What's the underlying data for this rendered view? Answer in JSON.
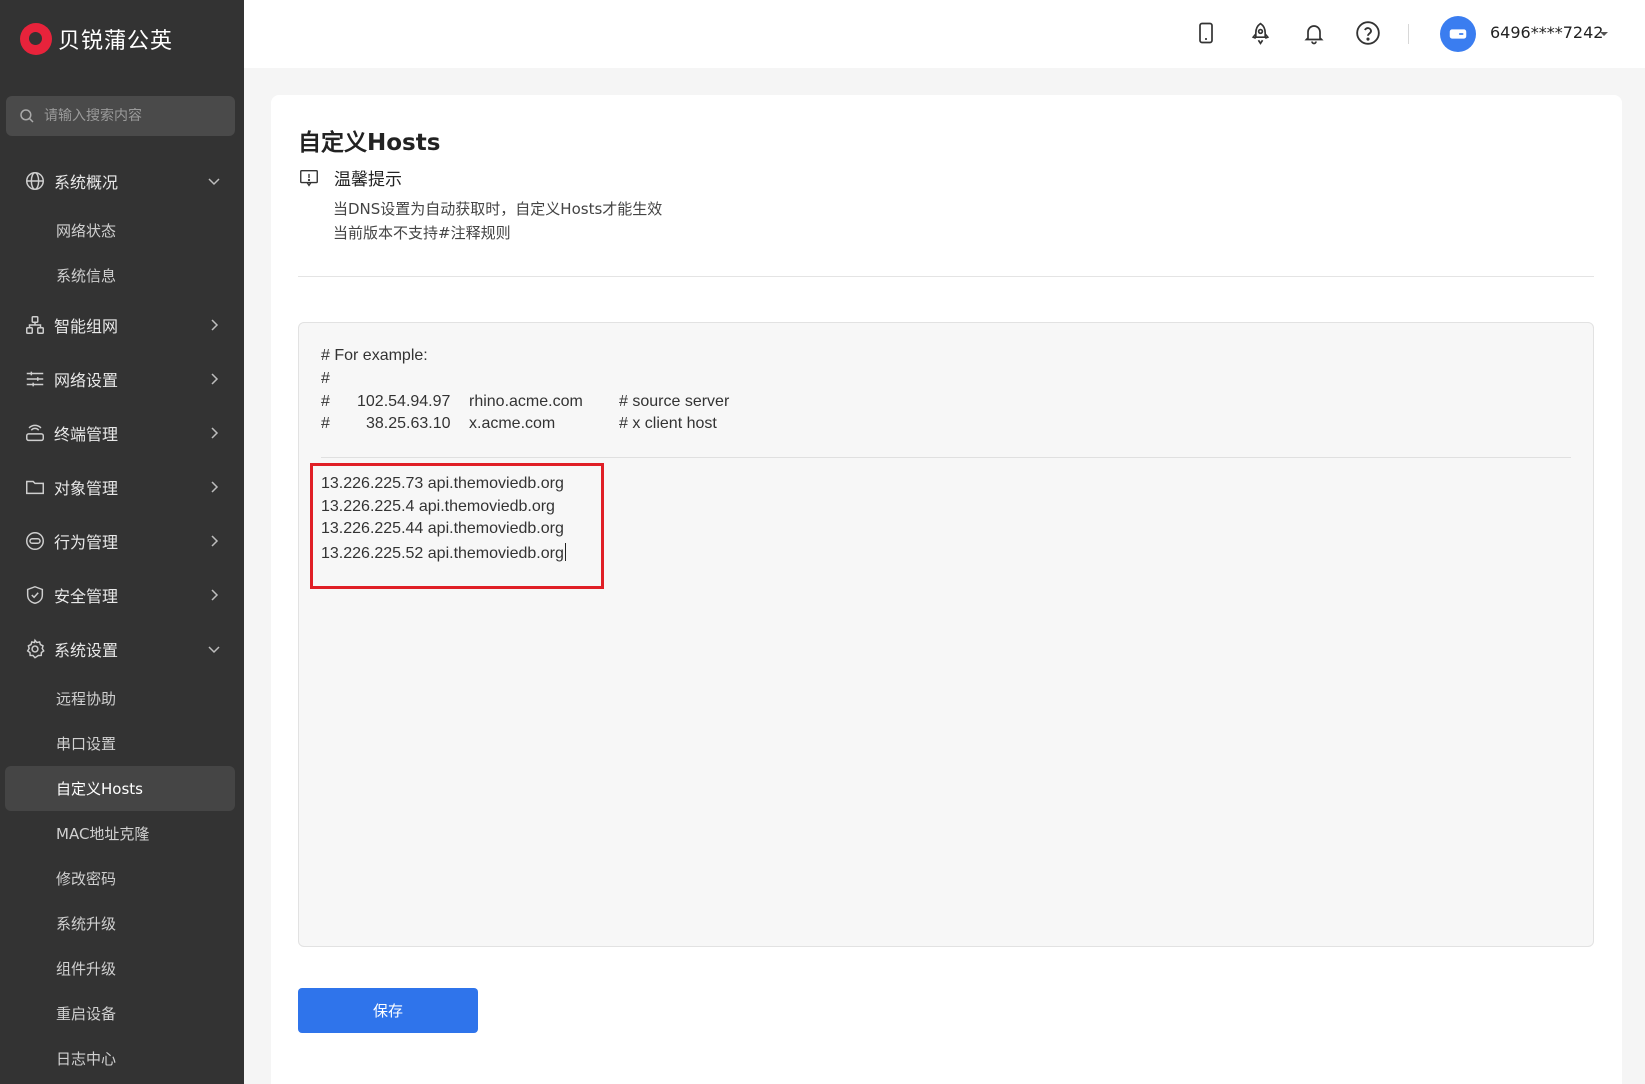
{
  "brand": {
    "name": "贝锐蒲公英"
  },
  "search": {
    "placeholder": "请输入搜索内容"
  },
  "sidebar": {
    "groups": [
      {
        "label": "系统概况",
        "icon": "globe-icon",
        "expanded": true,
        "items": [
          {
            "label": "网络状态"
          },
          {
            "label": "系统信息"
          }
        ]
      },
      {
        "label": "智能组网",
        "icon": "network-icon",
        "expanded": false
      },
      {
        "label": "网络设置",
        "icon": "sliders-icon",
        "expanded": false
      },
      {
        "label": "终端管理",
        "icon": "router-icon",
        "expanded": false
      },
      {
        "label": "对象管理",
        "icon": "folder-icon",
        "expanded": false
      },
      {
        "label": "行为管理",
        "icon": "link-icon",
        "expanded": false
      },
      {
        "label": "安全管理",
        "icon": "shield-icon",
        "expanded": false
      },
      {
        "label": "系统设置",
        "icon": "gear-icon",
        "expanded": true,
        "items": [
          {
            "label": "远程协助"
          },
          {
            "label": "串口设置"
          },
          {
            "label": "自定义Hosts",
            "active": true
          },
          {
            "label": "MAC地址克隆"
          },
          {
            "label": "修改密码"
          },
          {
            "label": "系统升级"
          },
          {
            "label": "组件升级"
          },
          {
            "label": "重启设备"
          },
          {
            "label": "日志中心"
          }
        ]
      }
    ]
  },
  "topbar": {
    "icons": [
      "phone-icon",
      "rocket-icon",
      "bell-icon",
      "help-icon"
    ],
    "username": "6496****7242"
  },
  "main": {
    "title": "自定义Hosts",
    "tip": {
      "title": "温馨提示",
      "lines": [
        "当DNS设置为自动获取时，自定义Hosts才能生效",
        "当前版本不支持#注释规则"
      ]
    },
    "example": {
      "header": "# For example:",
      "blank": "#",
      "rows": [
        {
          "hash": "#",
          "ip": "102.54.94.97",
          "host": "rhino.acme.com",
          "comment": "# source server"
        },
        {
          "hash": "#",
          "ip": "38.25.63.10",
          "host": "x.acme.com",
          "comment": "# x client host"
        }
      ]
    },
    "hosts": [
      "13.226.225.73 api.themoviedb.org",
      "13.226.225.4 api.themoviedb.org",
      "13.226.225.44 api.themoviedb.org",
      "13.226.225.52 api.themoviedb.org"
    ],
    "save_label": "保存"
  },
  "colors": {
    "sidebar_bg": "#333333",
    "accent": "#2f74eb",
    "highlight": "#e01f26",
    "brand": "#e8233b"
  }
}
